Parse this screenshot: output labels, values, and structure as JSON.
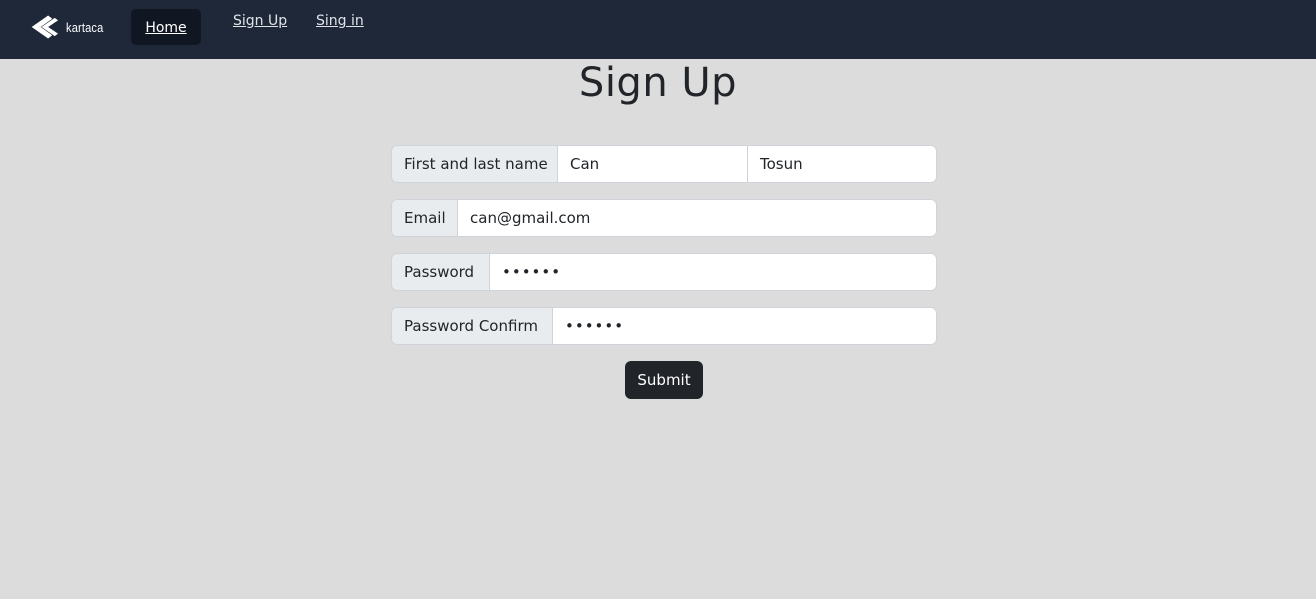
{
  "nav": {
    "brand": "kartaca",
    "links": [
      "Home",
      "Sign Up",
      "Sing in"
    ]
  },
  "page": {
    "title": "Sign Up"
  },
  "form": {
    "name_label": "First and last name",
    "first_name_value": "Can",
    "last_name_value": "Tosun",
    "email_label": "Email",
    "email_value": "can@gmail.com",
    "password_label": "Password",
    "password_value": "••••••",
    "password_confirm_label": "Password Confirm",
    "password_confirm_value": "••••••",
    "submit_label": "Submit"
  }
}
